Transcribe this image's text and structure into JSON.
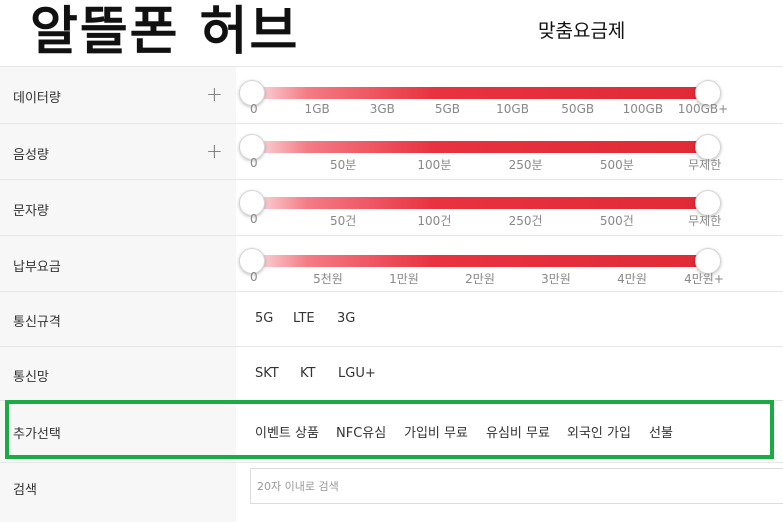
{
  "header": {
    "logo": "알뜰폰 허브",
    "title": "맞춤요금제"
  },
  "data_row": {
    "label": "데이터량",
    "plus": "+",
    "range": [
      0,
      1
    ],
    "ticks": [
      "0",
      "1GB",
      "3GB",
      "5GB",
      "10GB",
      "50GB",
      "100GB",
      "100GB+"
    ]
  },
  "voice_row": {
    "label": "음성량",
    "plus": "+",
    "range": [
      0,
      1
    ],
    "ticks": [
      "0",
      "50분",
      "100분",
      "250분",
      "500분",
      "무제한"
    ]
  },
  "sms_row": {
    "label": "문자량",
    "range": [
      0,
      1
    ],
    "ticks": [
      "0",
      "50건",
      "100건",
      "250건",
      "500건",
      "무제한"
    ]
  },
  "fee_row": {
    "label": "납부요금",
    "range": [
      0,
      1
    ],
    "ticks": [
      "0",
      "5천원",
      "1만원",
      "2만원",
      "3만원",
      "4만원",
      "4만원+"
    ]
  },
  "network_type": {
    "label": "통신규격",
    "options": [
      "5G",
      "LTE",
      "3G"
    ]
  },
  "carrier": {
    "label": "통신망",
    "options": [
      "SKT",
      "KT",
      "LGU+"
    ]
  },
  "extras": {
    "label": "추가선택",
    "options": [
      "이벤트 상품",
      "NFC유심",
      "가입비 무료",
      "유심비 무료",
      "외국인 가입",
      "선불"
    ]
  },
  "search": {
    "label": "검색",
    "placeholder": "20자 이내로 검색",
    "value": ""
  },
  "colors": {
    "accent": "#e02a36",
    "highlight": "#1aab45",
    "label_bg": "#f7f7f7"
  }
}
